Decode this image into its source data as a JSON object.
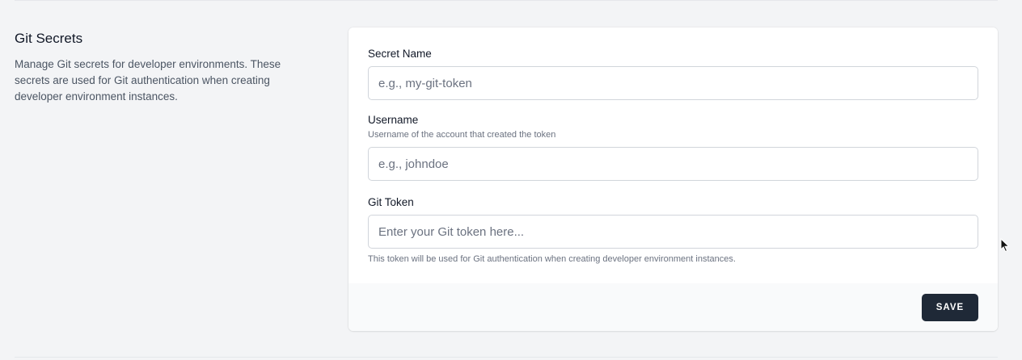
{
  "section": {
    "title": "Git Secrets",
    "description": "Manage Git secrets for developer environments. These secrets are used for Git authentication when creating developer environment instances."
  },
  "form": {
    "secret_name": {
      "label": "Secret Name",
      "placeholder": "e.g., my-git-token",
      "value": ""
    },
    "username": {
      "label": "Username",
      "help": "Username of the account that created the token",
      "placeholder": "e.g., johndoe",
      "value": ""
    },
    "git_token": {
      "label": "Git Token",
      "placeholder": "Enter your Git token here...",
      "help": "This token will be used for Git authentication when creating developer environment instances.",
      "value": ""
    },
    "save_label": "SAVE"
  },
  "colors": {
    "page_background": "#f3f4f6",
    "card_background": "#ffffff",
    "footer_background": "#f9fafb",
    "button_background": "#1f2937",
    "button_text": "#ffffff"
  },
  "icons": {
    "cursor": "mouse-pointer-icon"
  }
}
